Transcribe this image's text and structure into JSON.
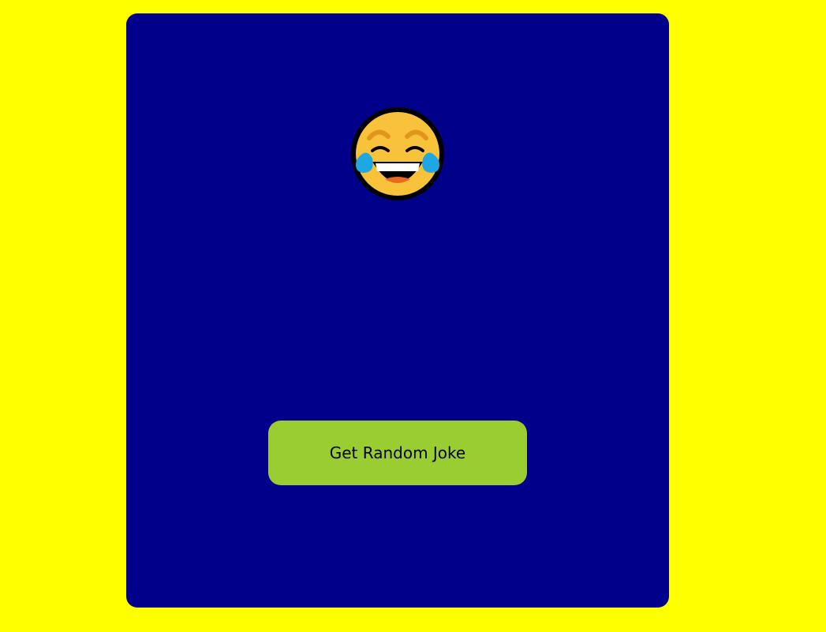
{
  "colors": {
    "page_background": "#ffff00",
    "card_background": "#00008b",
    "button_background": "#9acd32",
    "button_text": "#000000"
  },
  "emoji": {
    "icon": "face-with-tears-of-joy-icon"
  },
  "joke": {
    "text": ""
  },
  "button": {
    "label": "Get Random Joke"
  }
}
